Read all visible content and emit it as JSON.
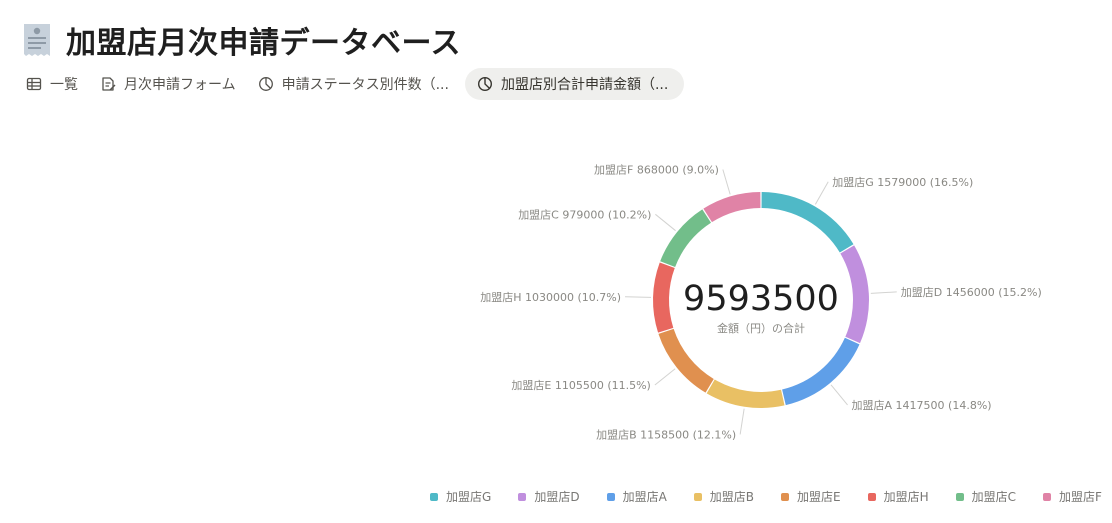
{
  "header": {
    "title": "加盟店月次申請データベース",
    "icon": "receipt-icon"
  },
  "tabs": [
    {
      "label": "一覧",
      "icon": "table-icon",
      "active": false
    },
    {
      "label": "月次申請フォーム",
      "icon": "form-edit-icon",
      "active": false
    },
    {
      "label": "申請ステータス別件数（...",
      "icon": "pie-chart-icon",
      "active": false
    },
    {
      "label": "加盟店別合計申請金額（...",
      "icon": "pie-chart-icon",
      "active": true
    }
  ],
  "chart_data": {
    "type": "pie",
    "donut": true,
    "center_value": "9593500",
    "center_caption": "金額（円）の合計",
    "slices": [
      {
        "label": "加盟店G",
        "value": 1579000,
        "percent_label": "1579000 (16.5%)",
        "color": "#4fb9c7"
      },
      {
        "label": "加盟店D",
        "value": 1456000,
        "percent_label": "1456000 (15.2%)",
        "color": "#c08fde"
      },
      {
        "label": "加盟店A",
        "value": 1417500,
        "percent_label": "1417500 (14.8%)",
        "color": "#5f9fe8"
      },
      {
        "label": "加盟店B",
        "value": 1158500,
        "percent_label": "1158500 (12.1%)",
        "color": "#e9c064"
      },
      {
        "label": "加盟店E",
        "value": 1105500,
        "percent_label": "1105500 (11.5%)",
        "color": "#e0904f"
      },
      {
        "label": "加盟店H",
        "value": 1030000,
        "percent_label": "1030000 (10.7%)",
        "color": "#e8675f"
      },
      {
        "label": "加盟店C",
        "value": 979000,
        "percent_label": "979000 (10.2%)",
        "color": "#72be8a"
      },
      {
        "label": "加盟店F",
        "value": 868000,
        "percent_label": "868000 (9.0%)",
        "color": "#e083a6"
      }
    ],
    "legend_position": "bottom"
  }
}
